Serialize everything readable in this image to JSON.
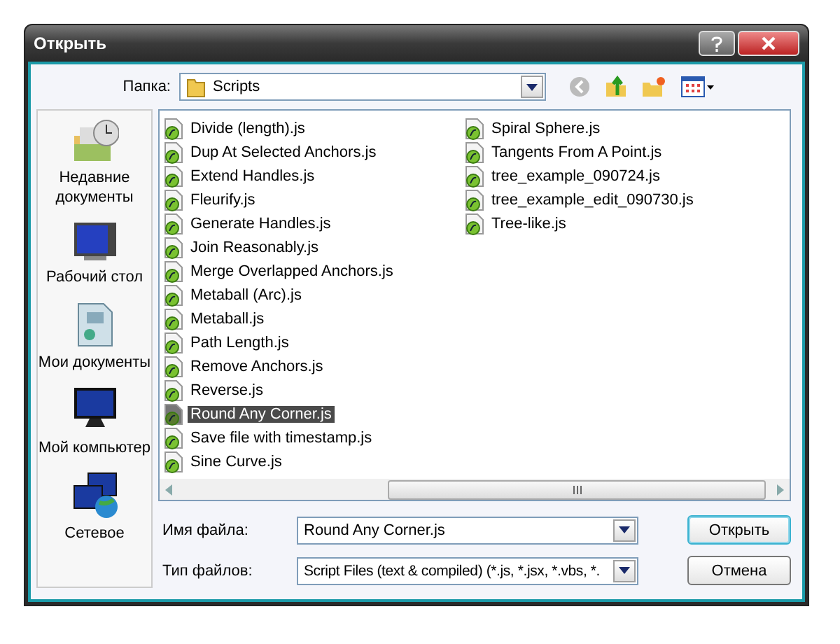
{
  "window": {
    "title": "Открыть"
  },
  "folder": {
    "label": "Папка:",
    "value": "Scripts"
  },
  "places": [
    {
      "kind": "recent",
      "label": "Недавние документы"
    },
    {
      "kind": "desktop",
      "label": "Рабочий стол"
    },
    {
      "kind": "documents",
      "label": "Мои документы"
    },
    {
      "kind": "computer",
      "label": "Мой компьютер"
    },
    {
      "kind": "network",
      "label": "Сетевое"
    }
  ],
  "files": [
    {
      "name": "Divide (length).js",
      "selected": false
    },
    {
      "name": "Dup At Selected Anchors.js",
      "selected": false
    },
    {
      "name": "Extend Handles.js",
      "selected": false
    },
    {
      "name": "Fleurify.js",
      "selected": false
    },
    {
      "name": "Generate Handles.js",
      "selected": false
    },
    {
      "name": "Join Reasonably.js",
      "selected": false
    },
    {
      "name": "Merge Overlapped Anchors.js",
      "selected": false
    },
    {
      "name": "Metaball (Arc).js",
      "selected": false
    },
    {
      "name": "Metaball.js",
      "selected": false
    },
    {
      "name": "Path Length.js",
      "selected": false
    },
    {
      "name": "Remove Anchors.js",
      "selected": false
    },
    {
      "name": "Reverse.js",
      "selected": false
    },
    {
      "name": "Round Any Corner.js",
      "selected": true
    },
    {
      "name": "Save file with timestamp.js",
      "selected": false
    },
    {
      "name": "Sine Curve.js",
      "selected": false
    },
    {
      "name": "Spiral Sphere.js",
      "selected": false
    },
    {
      "name": "Tangents From A Point.js",
      "selected": false
    },
    {
      "name": "tree_example_090724.js",
      "selected": false
    },
    {
      "name": "tree_example_edit_090730.js",
      "selected": false
    },
    {
      "name": "Tree-like.js",
      "selected": false
    }
  ],
  "filename": {
    "label": "Имя файла:",
    "value": "Round Any Corner.js"
  },
  "filetype": {
    "label": "Тип файлов:",
    "value": "Script Files (text & compiled) (*.js, *.jsx, *.vbs, *."
  },
  "buttons": [
    {
      "label": "Открыть",
      "kind": "default"
    },
    {
      "label": "Отмена",
      "kind": "normal"
    }
  ]
}
